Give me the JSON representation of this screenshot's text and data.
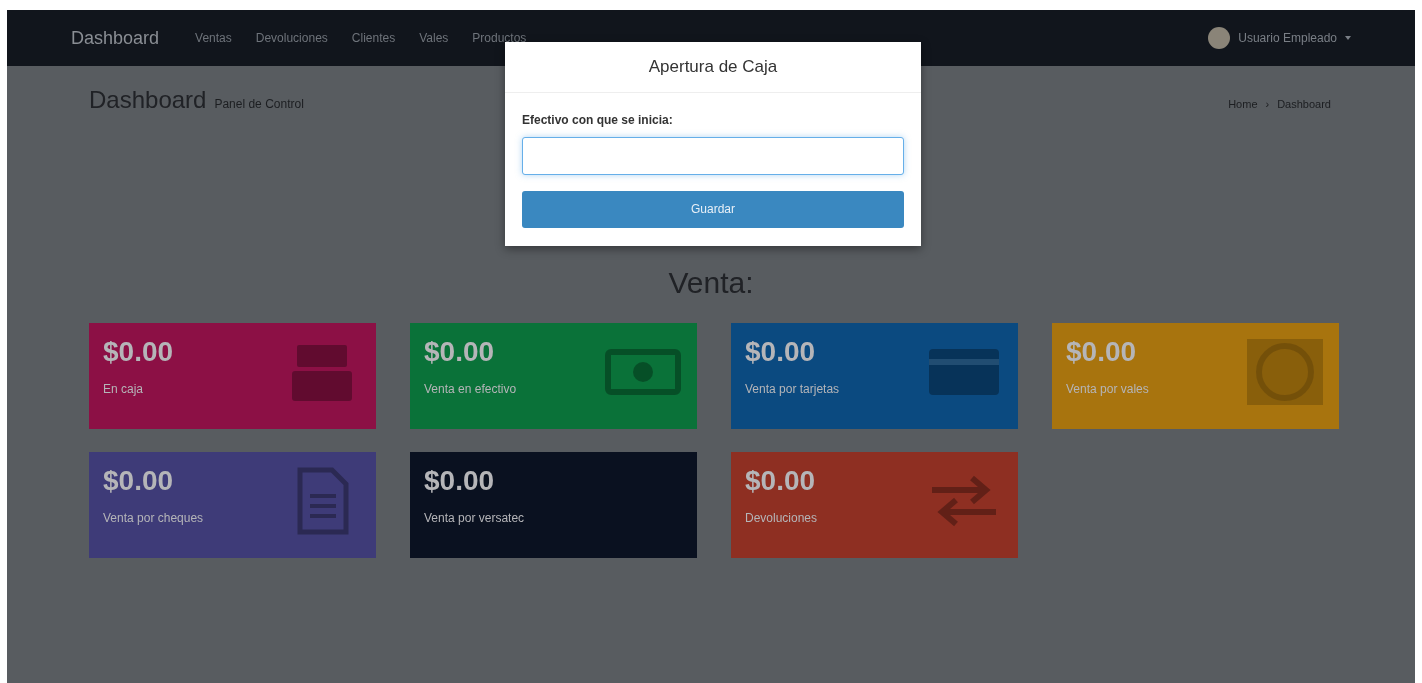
{
  "navbar": {
    "brand": "Dashboard",
    "links": [
      {
        "label": "Ventas",
        "selected": false
      },
      {
        "label": "Devoluciones",
        "selected": false
      },
      {
        "label": "Clientes",
        "selected": false
      },
      {
        "label": "Vales",
        "selected": false
      },
      {
        "label": "Productos",
        "selected": false
      }
    ],
    "user": "Usuario Empleado"
  },
  "header": {
    "title": "Dashboard",
    "subtitle": "Panel de Control",
    "breadcrumb": [
      "Home",
      "Dashboard"
    ],
    "separator": "›"
  },
  "section_title": "Venta:",
  "tiles": [
    {
      "amount": "$0.00",
      "label": "En caja",
      "color": "#8c1045",
      "kind": "register"
    },
    {
      "amount": "$0.00",
      "label": "Venta en efectivo",
      "color": "#0a7239",
      "kind": "bill"
    },
    {
      "amount": "$0.00",
      "label": "Venta por tarjetas",
      "color": "#0b4a80",
      "kind": "card"
    },
    {
      "amount": "$0.00",
      "label": "Venta por vales",
      "color": "#a8740e",
      "kind": "coin"
    },
    {
      "amount": "$0.00",
      "label": "Venta por cheques",
      "color": "#3e3b78",
      "kind": "document"
    },
    {
      "amount": "$0.00",
      "label": "Venta por versatec",
      "color": "#0a1120",
      "kind": "blank"
    },
    {
      "amount": "$0.00",
      "label": "Devoluciones",
      "color": "#8e2f22",
      "kind": "exchange"
    }
  ],
  "modal": {
    "title": "Apertura de Caja",
    "field_label": "Efectivo con que se inicia:",
    "button": "Guardar"
  }
}
